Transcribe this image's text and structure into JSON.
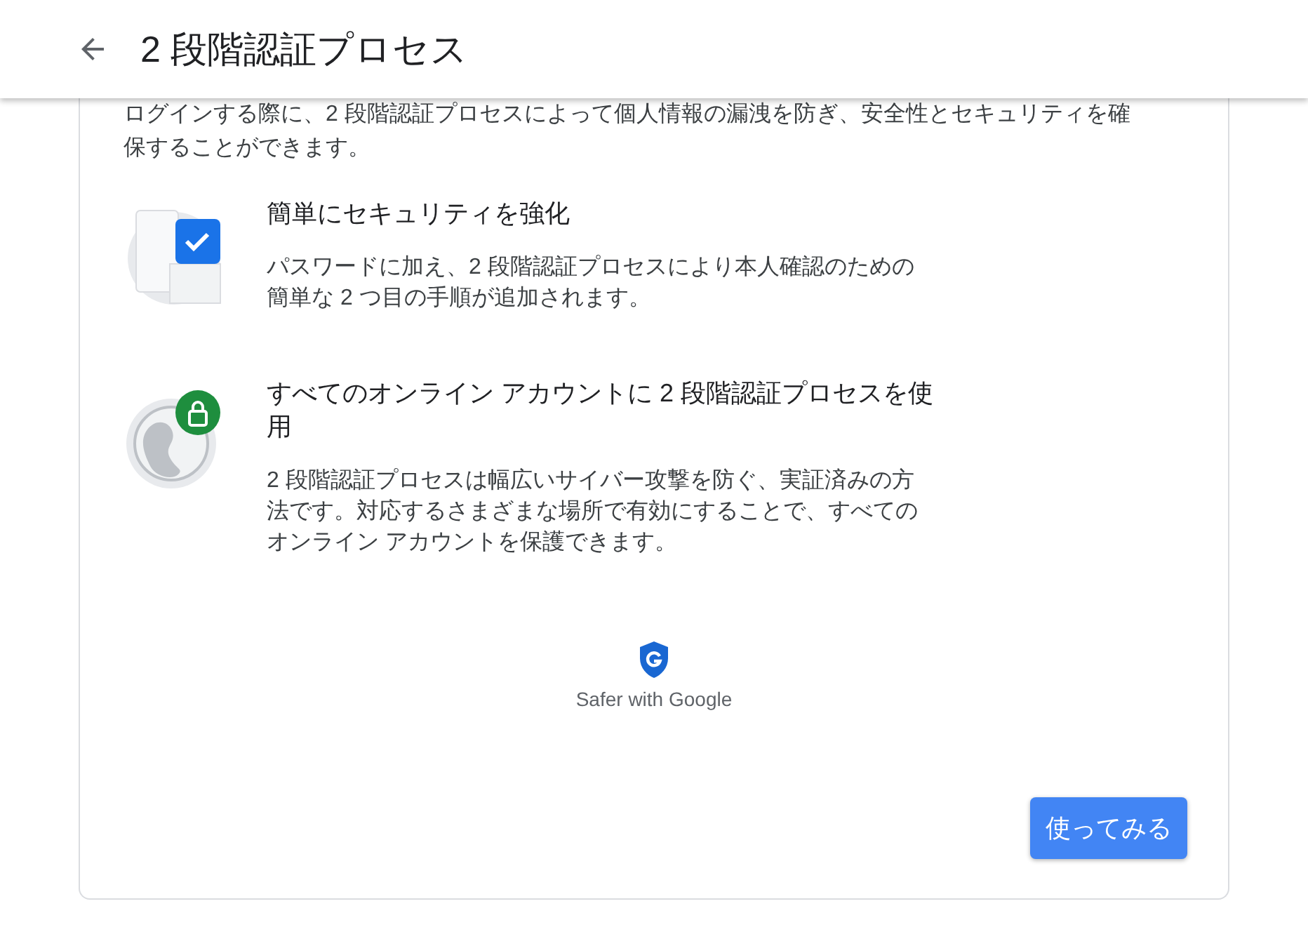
{
  "header": {
    "title": "2 段階認証プロセス"
  },
  "page": {
    "intro": "ログインする際に、2 段階認証プロセスによって個人情報の漏洩を防ぎ、安全性とセキュリティを確保することができます。",
    "features": [
      {
        "kind": "phone",
        "title": "簡単にセキュリティを強化",
        "description": "パスワードに加え、2 段階認証プロセスにより本人確認のための簡単な 2 つ目の手順が追加されます。"
      },
      {
        "kind": "globe",
        "title": "すべてのオンライン アカウントに 2 段階認証プロセスを使用",
        "description": "2 段階認証プロセスは幅広いサイバー攻撃を防ぐ、実証済みの方法です。対応するさまざまな場所で有効にすることで、すべてのオンライン アカウントを保護できます。"
      }
    ],
    "badge": "Safer with Google",
    "button": "使ってみる"
  }
}
